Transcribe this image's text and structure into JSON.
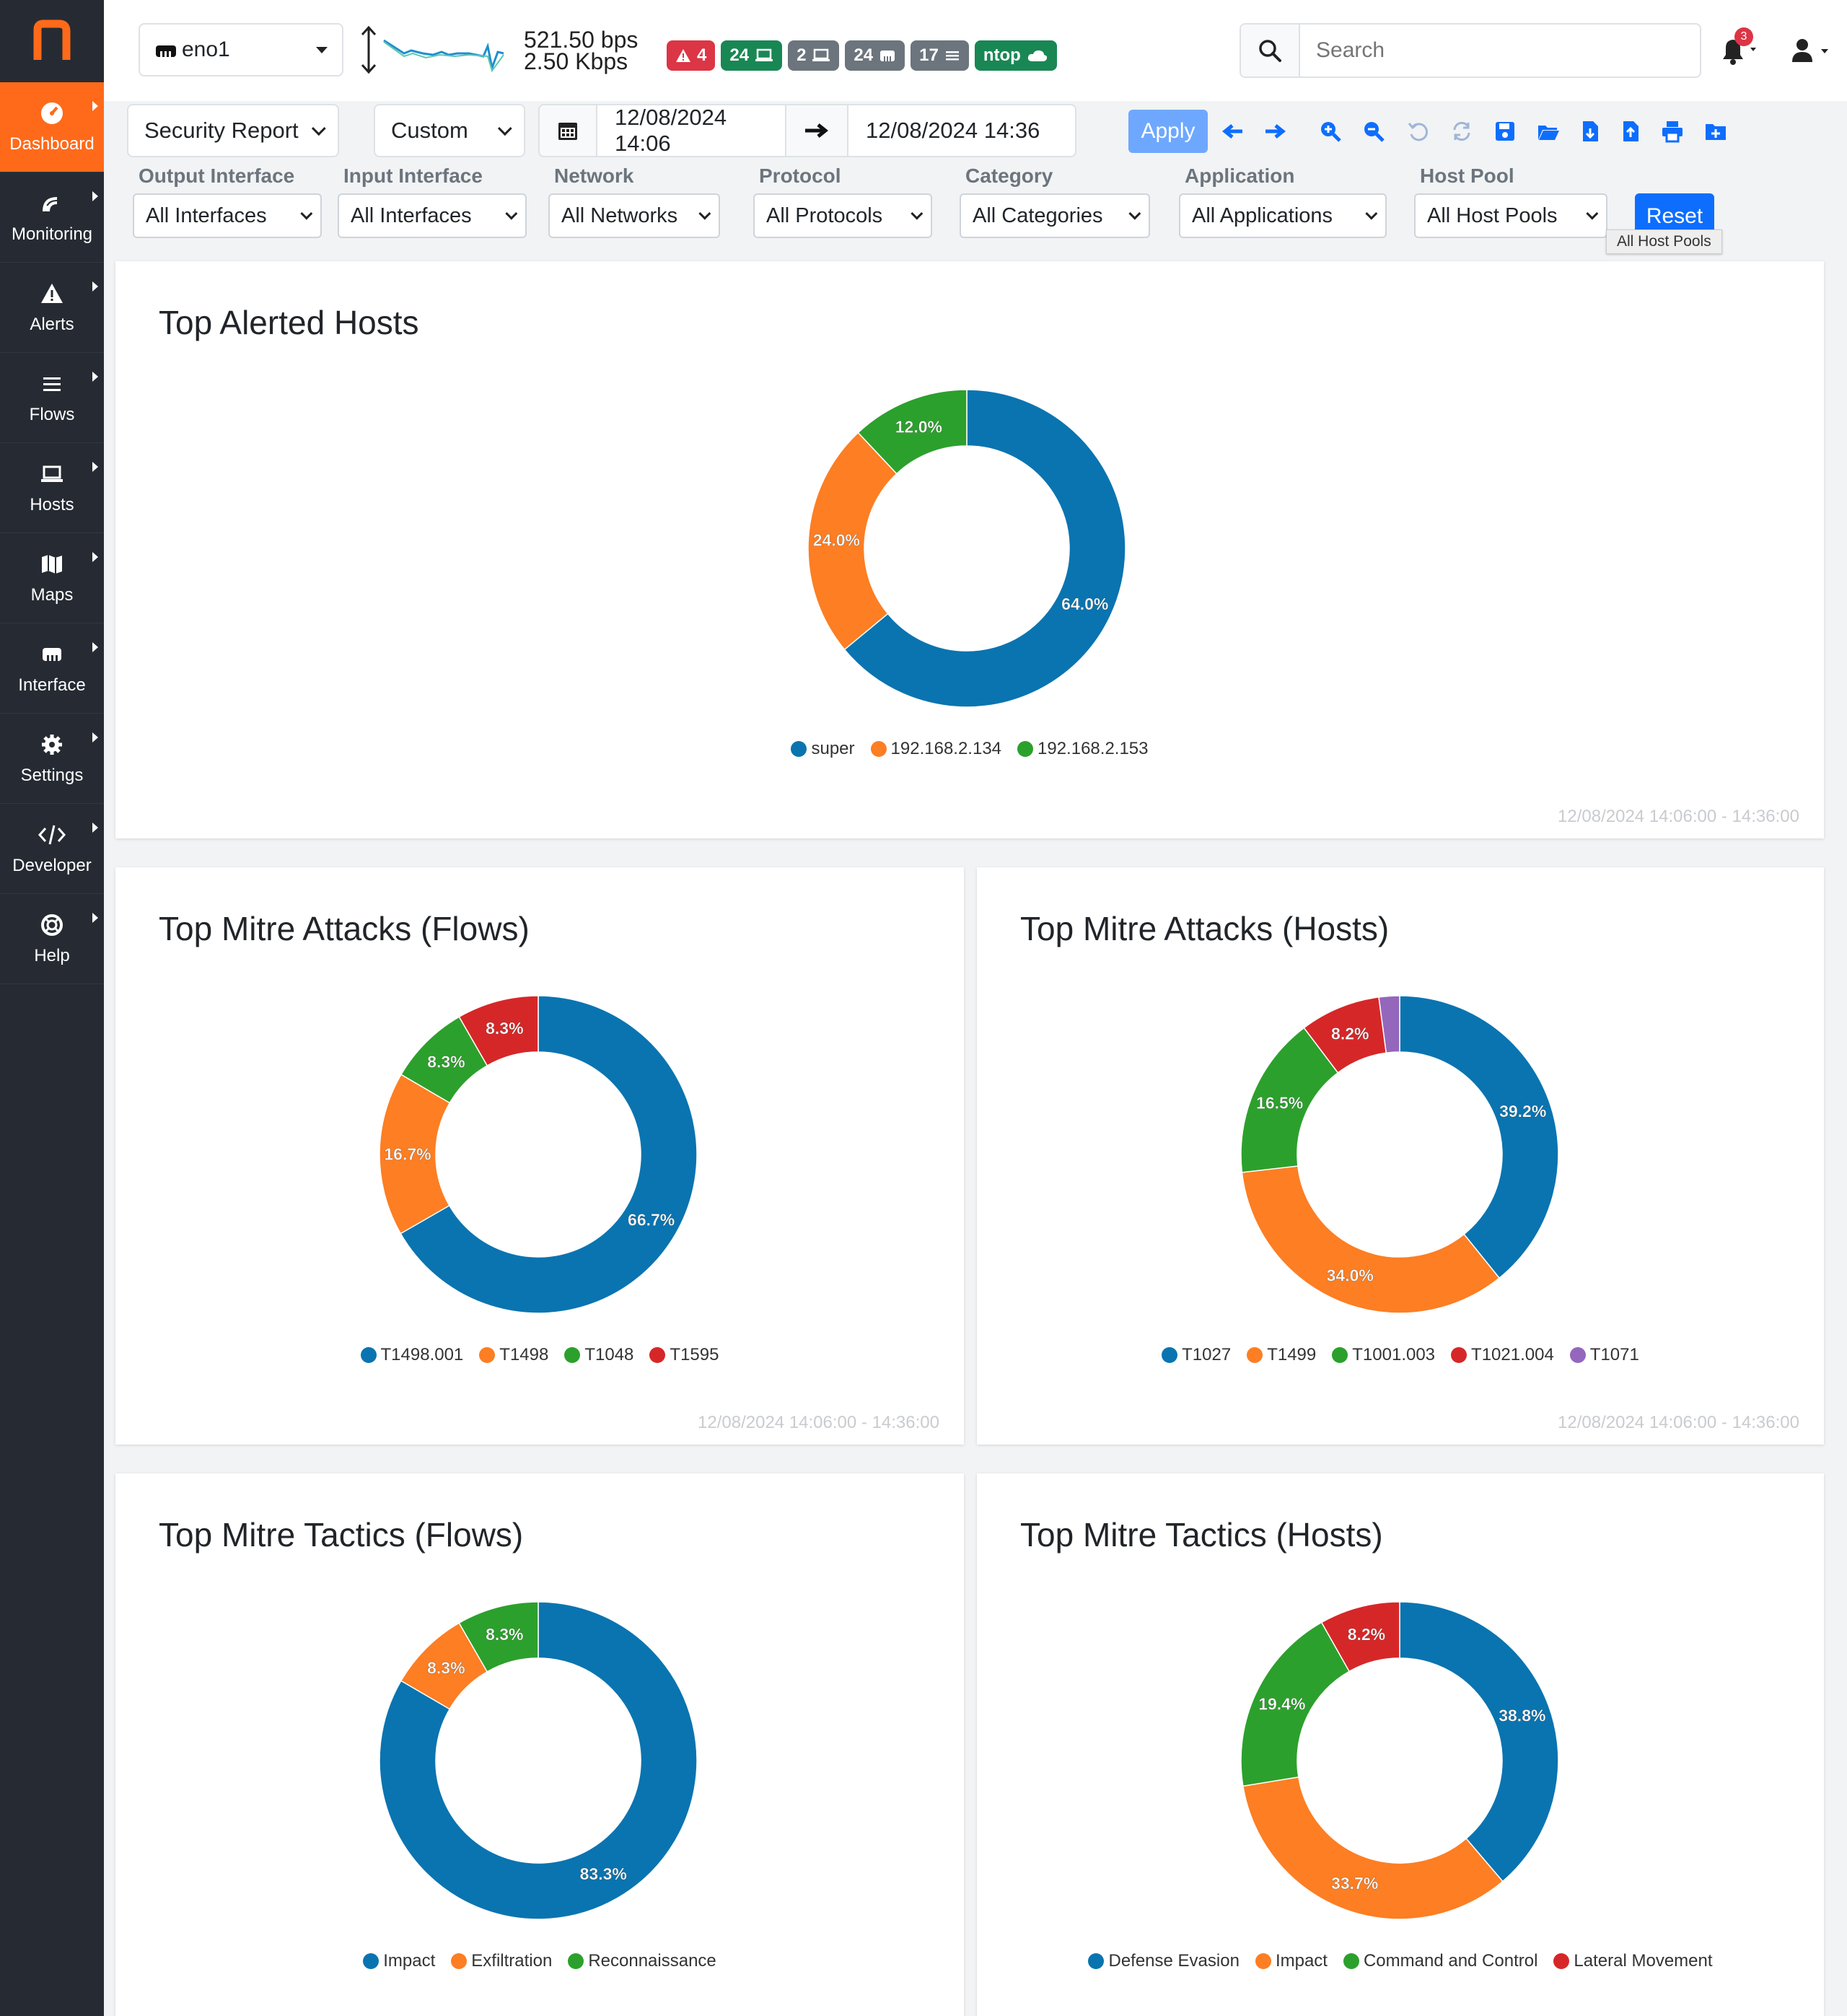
{
  "sidebar": {
    "logo": "n",
    "items": [
      {
        "label": "Dashboard",
        "icon": "dashboard-icon",
        "active": true
      },
      {
        "label": "Monitoring",
        "icon": "monitoring-icon"
      },
      {
        "label": "Alerts",
        "icon": "alerts-icon"
      },
      {
        "label": "Flows",
        "icon": "flows-icon"
      },
      {
        "label": "Hosts",
        "icon": "hosts-icon"
      },
      {
        "label": "Maps",
        "icon": "maps-icon"
      },
      {
        "label": "Interface",
        "icon": "interface-icon"
      },
      {
        "label": "Settings",
        "icon": "settings-icon"
      },
      {
        "label": "Developer",
        "icon": "developer-icon"
      },
      {
        "label": "Help",
        "icon": "help-icon"
      }
    ]
  },
  "header": {
    "interface": "eno1",
    "rate_up": "521.50 bps",
    "rate_down": "2.50 Kbps",
    "badges": [
      {
        "text": "4",
        "color": "red",
        "icon": "alert-icon"
      },
      {
        "text": "24",
        "color": "green",
        "icon": "host-icon"
      },
      {
        "text": "2",
        "color": "gray",
        "icon": "host-icon"
      },
      {
        "text": "24",
        "color": "gray",
        "icon": "interface-icon"
      },
      {
        "text": "17",
        "color": "gray",
        "icon": "flows-icon"
      },
      {
        "text": "ntop",
        "color": "green",
        "icon": "cloud-icon"
      }
    ],
    "search_placeholder": "Search",
    "notification_count": "3"
  },
  "toolbar": {
    "report": "Security Report",
    "period": "Custom",
    "date_from": "12/08/2024 14:06",
    "date_to": "12/08/2024 14:36",
    "apply": "Apply"
  },
  "filters": [
    {
      "label": "Output Interface",
      "value": "All Interfaces"
    },
    {
      "label": "Input Interface",
      "value": "All Interfaces"
    },
    {
      "label": "Network",
      "value": "All Networks"
    },
    {
      "label": "Protocol",
      "value": "All Protocols"
    },
    {
      "label": "Category",
      "value": "All Categories"
    },
    {
      "label": "Application",
      "value": "All Applications"
    },
    {
      "label": "Host Pool",
      "value": "All Host Pools"
    }
  ],
  "reset": "Reset",
  "tooltip": "All Host Pools",
  "colors": {
    "blue": "#0a74b0",
    "orange": "#fd7e23",
    "green": "#2ca02c",
    "red": "#d62728",
    "purple": "#9467bd",
    "accent": "#ff6a1a"
  },
  "chart_data": [
    {
      "type": "pie",
      "title": "Top Alerted Hosts",
      "categories": [
        "super",
        "192.168.2.134",
        "192.168.2.153"
      ],
      "values": [
        64.0,
        24.0,
        12.0
      ],
      "labels": [
        "64.0%",
        "24.0%",
        "12.0%"
      ],
      "colors": [
        "#0a74b0",
        "#fd7e23",
        "#2ca02c"
      ],
      "range": "12/08/2024 14:06:00 - 14:36:00"
    },
    {
      "type": "pie",
      "title": "Top Mitre Attacks (Flows)",
      "categories": [
        "T1498.001",
        "T1498",
        "T1048",
        "T1595"
      ],
      "values": [
        66.7,
        16.7,
        8.3,
        8.3
      ],
      "labels": [
        "66.7%",
        "16.7%",
        "8.3%",
        "8.3%"
      ],
      "colors": [
        "#0a74b0",
        "#fd7e23",
        "#2ca02c",
        "#d62728"
      ],
      "range": "12/08/2024 14:06:00 - 14:36:00"
    },
    {
      "type": "pie",
      "title": "Top Mitre Attacks (Hosts)",
      "categories": [
        "T1027",
        "T1499",
        "T1001.003",
        "T1021.004",
        "T1071"
      ],
      "values": [
        39.2,
        34.0,
        16.5,
        8.2,
        2.1
      ],
      "labels": [
        "39.2%",
        "34.0%",
        "16.5%",
        "8.2%",
        ""
      ],
      "colors": [
        "#0a74b0",
        "#fd7e23",
        "#2ca02c",
        "#d62728",
        "#9467bd"
      ],
      "range": "12/08/2024 14:06:00 - 14:36:00"
    },
    {
      "type": "pie",
      "title": "Top Mitre Tactics (Flows)",
      "categories": [
        "Impact",
        "Exfiltration",
        "Reconnaissance"
      ],
      "values": [
        83.3,
        8.3,
        8.3
      ],
      "labels": [
        "83.3%",
        "8.3%",
        "8.3%"
      ],
      "colors": [
        "#0a74b0",
        "#fd7e23",
        "#2ca02c"
      ],
      "range": ""
    },
    {
      "type": "pie",
      "title": "Top Mitre Tactics (Hosts)",
      "categories": [
        "Defense Evasion",
        "Impact",
        "Command and Control",
        "Lateral Movement"
      ],
      "values": [
        38.8,
        33.7,
        19.4,
        8.2
      ],
      "labels": [
        "38.8%",
        "33.7%",
        "19.4%",
        "8.2%"
      ],
      "colors": [
        "#0a74b0",
        "#fd7e23",
        "#2ca02c",
        "#d62728"
      ],
      "range": ""
    }
  ]
}
